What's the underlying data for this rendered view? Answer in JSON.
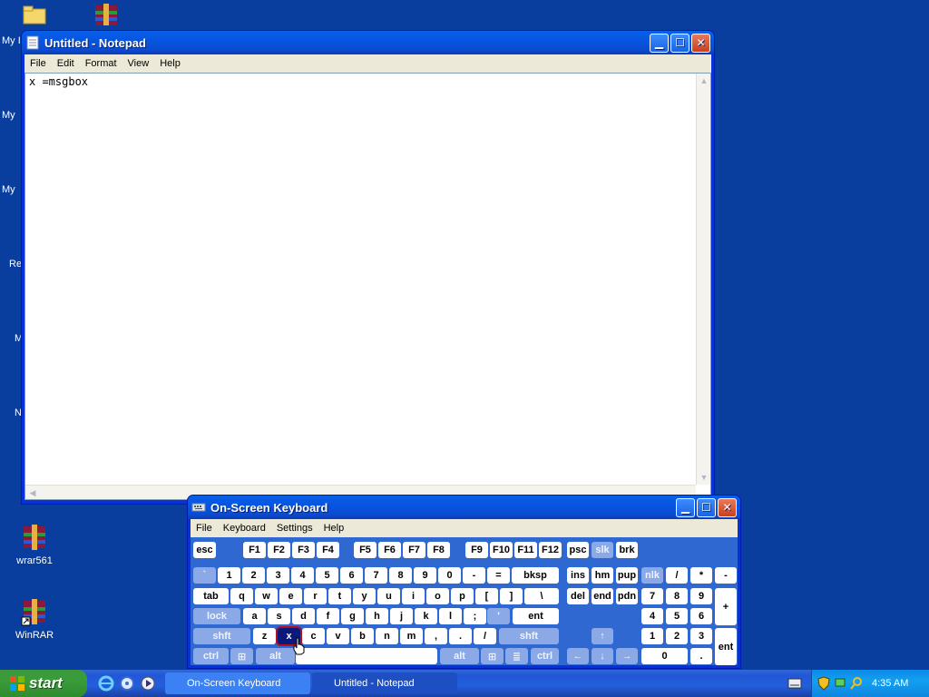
{
  "desktop": {
    "icons": [
      {
        "label": "wrar561"
      },
      {
        "label": "WinRAR"
      }
    ],
    "partial_labels": [
      "My I",
      "My",
      "My",
      "Re",
      "M",
      "N"
    ]
  },
  "notepad": {
    "title": "Untitled - Notepad",
    "menu": [
      "File",
      "Edit",
      "Format",
      "View",
      "Help"
    ],
    "content": "x =msgbox"
  },
  "osk": {
    "title": "On-Screen Keyboard",
    "menu": [
      "File",
      "Keyboard",
      "Settings",
      "Help"
    ],
    "selected_key": "x"
  },
  "taskbar": {
    "start_label": "start",
    "tasks": [
      {
        "label": "On-Screen Keyboard"
      },
      {
        "label": "Untitled - Notepad"
      }
    ],
    "clock": "4:35 AM"
  },
  "colors": {
    "desktop": "#0a3e9e",
    "titlebar": "#0655e0",
    "osk_body": "#2e68d0",
    "selected_key": "#0b1a7a"
  }
}
